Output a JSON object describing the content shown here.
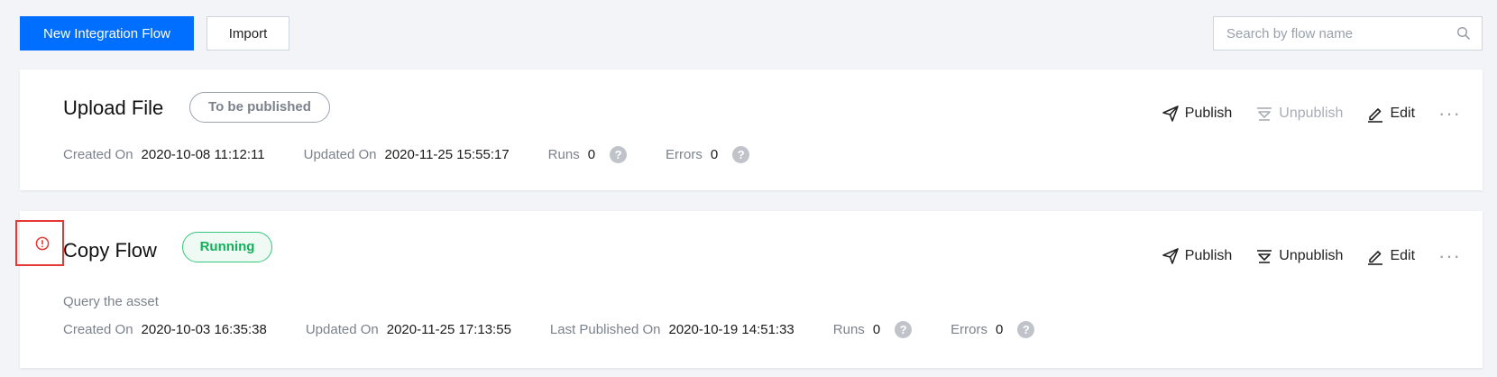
{
  "toolbar": {
    "new_flow_label": "New Integration Flow",
    "import_label": "Import",
    "search_placeholder": "Search by flow name"
  },
  "colors": {
    "primary": "#006eff",
    "running_green": "#13b05b",
    "alert_red": "#e53935",
    "muted": "#7c828c"
  },
  "flows": [
    {
      "name": "Upload File",
      "status": "To be published",
      "actions": {
        "publish": "Publish",
        "unpublish": "Unpublish",
        "edit": "Edit"
      },
      "unpublish_enabled": false,
      "meta": {
        "created_label": "Created On",
        "created_value": "2020-10-08 11:12:11",
        "updated_label": "Updated On",
        "updated_value": "2020-11-25 15:55:17",
        "runs_label": "Runs",
        "runs_value": "0",
        "errors_label": "Errors",
        "errors_value": "0"
      }
    },
    {
      "name": "Copy Flow",
      "status": "Running",
      "description": "Query the asset",
      "actions": {
        "publish": "Publish",
        "unpublish": "Unpublish",
        "edit": "Edit"
      },
      "unpublish_enabled": true,
      "meta": {
        "created_label": "Created On",
        "created_value": "2020-10-03 16:35:38",
        "updated_label": "Updated On",
        "updated_value": "2020-11-25 17:13:55",
        "published_label": "Last Published On",
        "published_value": "2020-10-19 14:51:33",
        "runs_label": "Runs",
        "runs_value": "0",
        "errors_label": "Errors",
        "errors_value": "0"
      }
    }
  ],
  "icons": {
    "help": "?",
    "more": "···"
  }
}
